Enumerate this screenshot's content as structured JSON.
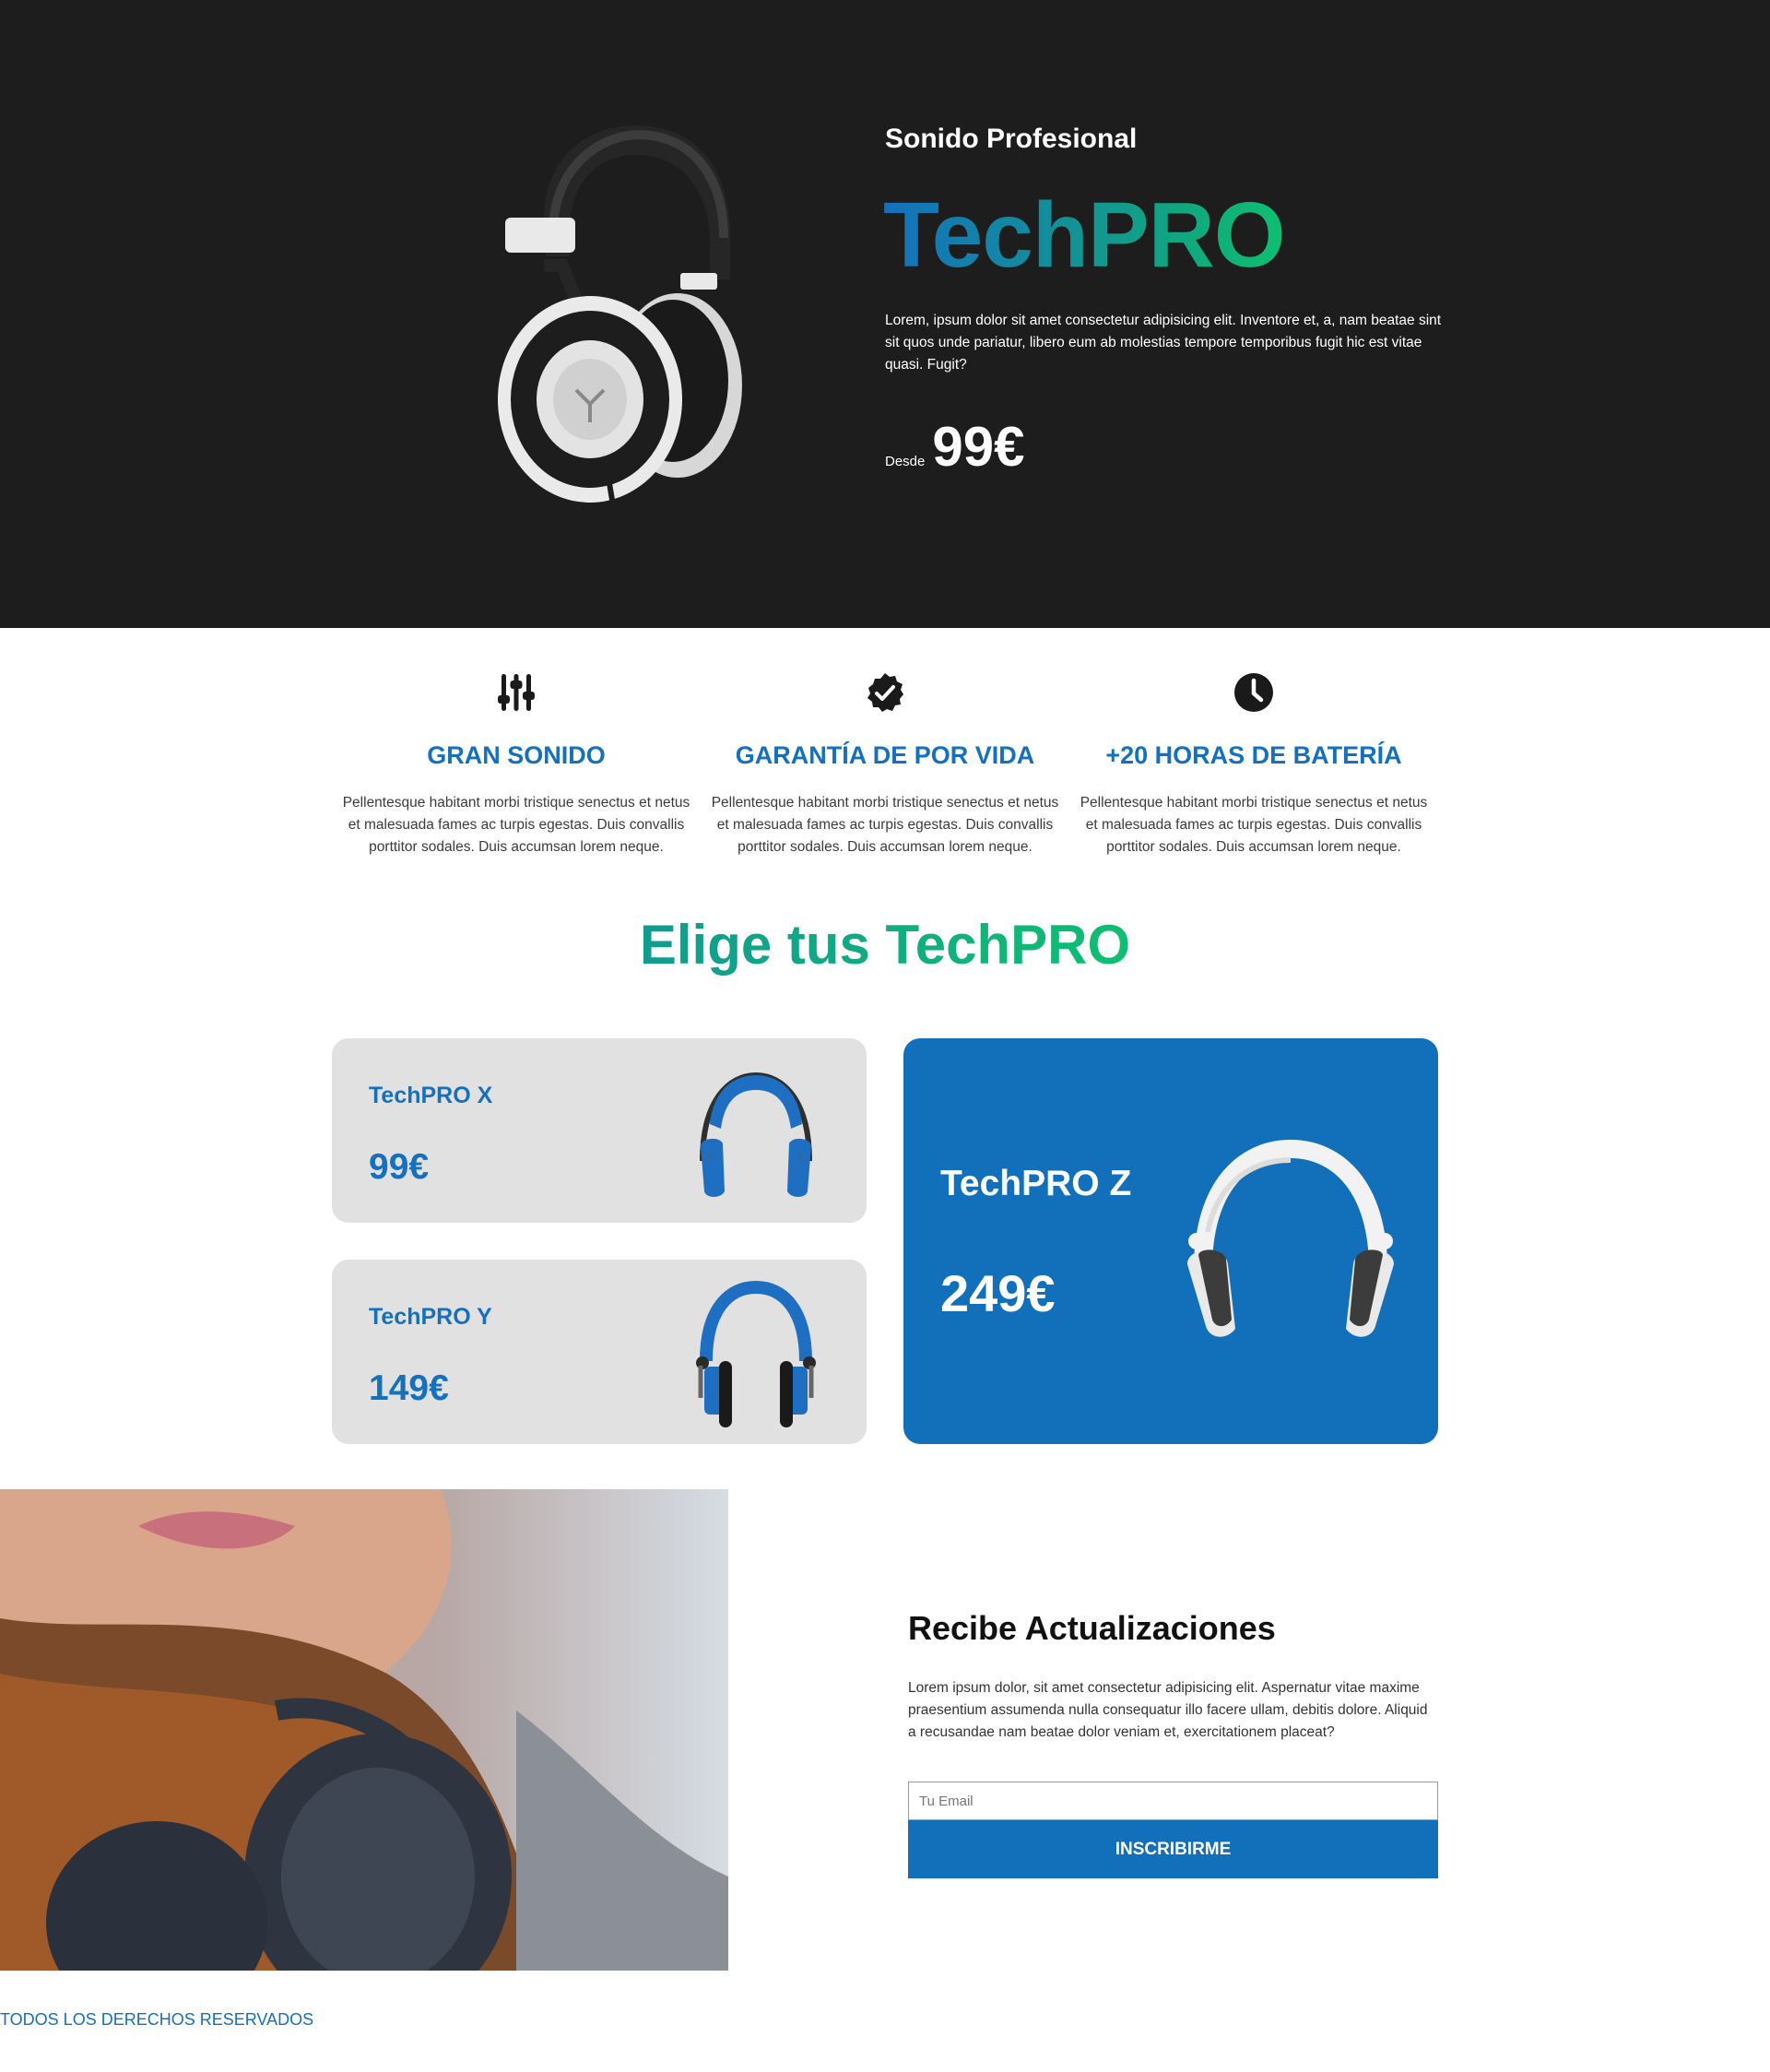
{
  "hero": {
    "subtitle": "Sonido Profesional",
    "title": "TechPRO",
    "text": "Lorem, ipsum dolor sit amet consectetur adipisicing elit. Inventore et, a, nam beatae sint sit quos unde pariatur, libero eum ab molestias tempore temporibus fugit hic est vitae quasi. Fugit?",
    "price_prefix": "Desde",
    "price": "99€"
  },
  "features": [
    {
      "icon": "equalizer-sliders-icon",
      "title": "GRAN SONIDO",
      "text": "Pellentesque habitant morbi tristique senectus et netus et malesuada fames ac turpis egestas. Duis convallis porttitor sodales. Duis accumsan lorem neque."
    },
    {
      "icon": "badge-check-icon",
      "title": "GARANTÍA DE POR VIDA",
      "text": "Pellentesque habitant morbi tristique senectus et netus et malesuada fames ac turpis egestas. Duis convallis porttitor sodales. Duis accumsan lorem neque."
    },
    {
      "icon": "clock-icon",
      "title": "+20 HORAS DE BATERÍA",
      "text": "Pellentesque habitant morbi tristique senectus et netus et malesuada fames ac turpis egestas. Duis convallis porttitor sodales. Duis accumsan lorem neque."
    }
  ],
  "choose": {
    "title": "Elige tus TechPRO",
    "products": [
      {
        "name": "TechPRO X",
        "price": "99€",
        "icon": "headphones-icon"
      },
      {
        "name": "TechPRO Y",
        "price": "149€",
        "icon": "headphones-icon"
      },
      {
        "name": "TechPRO Z",
        "price": "249€",
        "icon": "headphones-icon"
      }
    ]
  },
  "newsletter": {
    "title": "Recibe Actualizaciones",
    "text": "Lorem ipsum dolor, sit amet consectetur adipisicing elit. Aspernatur vitae maxime praesentium assumenda nulla consequatur illo facere ullam, debitis dolore. Aliquid a recusandae nam beatae dolor veniam et, exercitationem placeat?",
    "email_placeholder": "Tu Email",
    "button": "INSCRIBIRME"
  },
  "footer": {
    "text": "TODOS LOS DERECHOS RESERVADOS"
  },
  "colors": {
    "hero_bg": "#1d1d1e",
    "brand_blue": "#1270bb",
    "brand_green": "#0fbf70",
    "card_grey": "#e1e1e1"
  }
}
